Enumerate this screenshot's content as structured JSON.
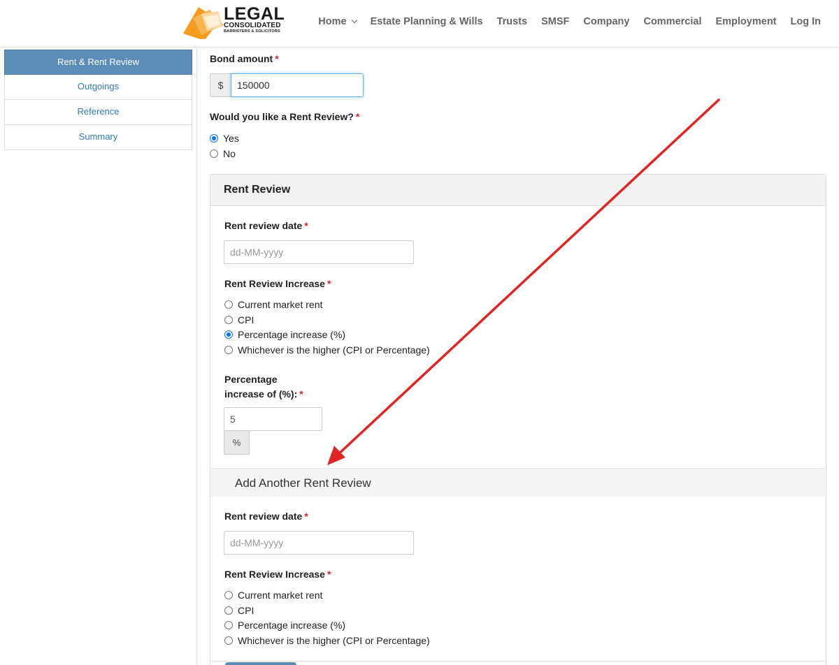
{
  "header": {
    "logo_title": "LEGAL",
    "logo_sub": "CONSOLIDATED",
    "logo_sub2": "BARRISTERS & SOLICITORS",
    "nav": [
      {
        "label": "Home",
        "has_dropdown": true
      },
      {
        "label": "Estate Planning & Wills"
      },
      {
        "label": "Trusts"
      },
      {
        "label": "SMSF"
      },
      {
        "label": "Company"
      },
      {
        "label": "Commercial"
      },
      {
        "label": "Employment"
      },
      {
        "label": "Log In"
      }
    ]
  },
  "sidebar": {
    "items": [
      {
        "label": "Rent & Rent Review",
        "active": true
      },
      {
        "label": "Outgoings"
      },
      {
        "label": "Reference"
      },
      {
        "label": "Summary"
      }
    ]
  },
  "form": {
    "required_mark": "*",
    "bond": {
      "label": "Bond amount",
      "currency": "$",
      "value": "150000"
    },
    "rent_review_question": {
      "label": "Would you like a Rent Review?",
      "options": [
        {
          "label": "Yes",
          "checked": true
        },
        {
          "label": "No",
          "checked": false
        }
      ]
    },
    "panel": {
      "title": "Rent Review",
      "review1": {
        "date_label": "Rent review date",
        "date_placeholder": "dd-MM-yyyy",
        "increase_label": "Rent Review Increase",
        "options": [
          {
            "label": "Current market rent",
            "checked": false
          },
          {
            "label": "CPI",
            "checked": false
          },
          {
            "label": "Percentage increase (%)",
            "checked": true
          },
          {
            "label": "Whichever is the higher (CPI or Percentage)",
            "checked": false
          }
        ],
        "pct_label_line1": "Percentage",
        "pct_label_line2": "increase of (%):",
        "pct_value": "5",
        "pct_addon": "%"
      },
      "add_another": "Add Another Rent Review",
      "review2": {
        "date_label": "Rent review date",
        "date_placeholder": "dd-MM-yyyy",
        "increase_label": "Rent Review Increase",
        "options": [
          {
            "label": "Current market rent",
            "checked": false
          },
          {
            "label": "CPI",
            "checked": false
          },
          {
            "label": "Percentage increase (%)",
            "checked": false
          },
          {
            "label": "Whichever is the higher (CPI or Percentage)",
            "checked": false
          }
        ]
      }
    }
  },
  "colors": {
    "sidebar_active": "#5b8db8",
    "link": "#337ab7",
    "required": "#d9232d",
    "radio_checked": "#0075ff",
    "annotation_arrow": "#e02424",
    "logo_orange": "#f39c1f"
  }
}
